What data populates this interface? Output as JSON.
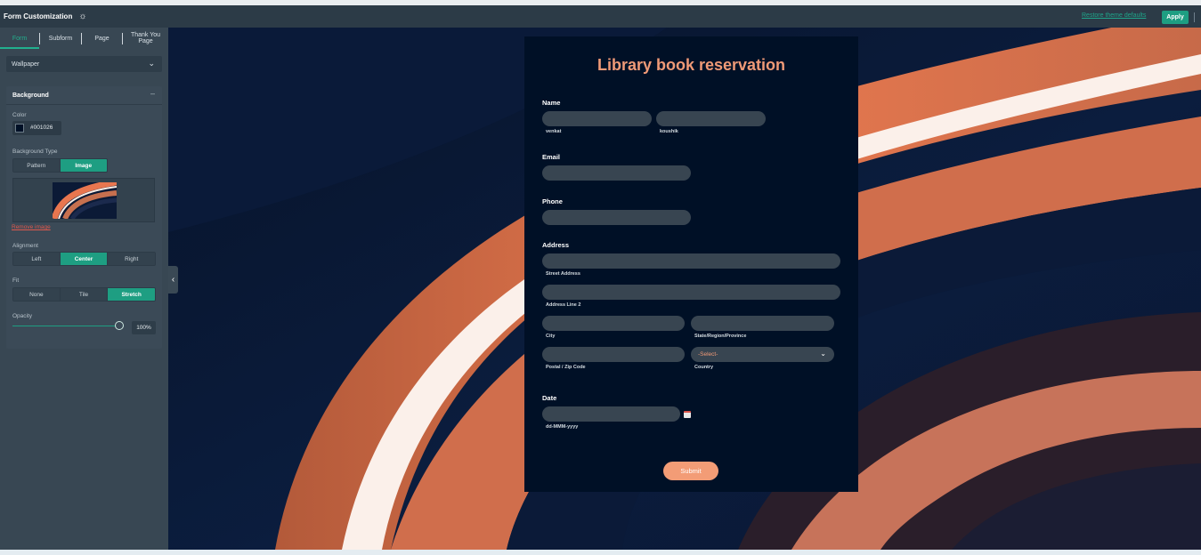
{
  "header": {
    "title": "Form Customization",
    "restore_label": "Restore theme defaults",
    "apply_label": "Apply"
  },
  "sidebar": {
    "tabs": [
      {
        "label": "Form",
        "active": true
      },
      {
        "label": "Subform",
        "active": false
      },
      {
        "label": "Page",
        "active": false
      },
      {
        "label": "Thank You Page",
        "active": false
      }
    ],
    "wallpaper_label": "Wallpaper",
    "background": {
      "title": "Background",
      "color_label": "Color",
      "color_value": "#001026",
      "type_label": "Background Type",
      "type_options": [
        "Pattern",
        "Image"
      ],
      "type_selected": "Image",
      "remove_image_label": "Remove image",
      "alignment_label": "Alignment",
      "alignment_options": [
        "Left",
        "Center",
        "Right"
      ],
      "alignment_selected": "Center",
      "fit_label": "Fit",
      "fit_options": [
        "None",
        "Tile",
        "Stretch"
      ],
      "fit_selected": "Stretch",
      "opacity_label": "Opacity",
      "opacity_value": "100%"
    }
  },
  "form": {
    "title": "Library book reservation",
    "name": {
      "label": "Name",
      "first_sub": "venkat",
      "last_sub": "koushik"
    },
    "email": {
      "label": "Email"
    },
    "phone": {
      "label": "Phone"
    },
    "address": {
      "label": "Address",
      "street_sub": "Street Address",
      "line2_sub": "Address Line 2",
      "city_sub": "City",
      "state_sub": "State/Region/Province",
      "zip_sub": "Postal / Zip Code",
      "country_sub": "Country",
      "country_value": "-Select-"
    },
    "date": {
      "label": "Date",
      "format_sub": "dd-MMM-yyyy"
    },
    "submit_label": "Submit"
  },
  "colors": {
    "accent": "#1e9e82",
    "form_bg": "#001026",
    "title": "#f09a77",
    "submit": "#f39c76",
    "header_bg": "#2c3b47",
    "sidebar_bg": "#384753"
  },
  "icons": {
    "theme": "sun-icon",
    "wallpaper_dropdown": "chevron-down-icon",
    "collapse": "chevron-left-icon",
    "date": "calendar-icon",
    "country_dropdown": "chevron-down-icon"
  }
}
